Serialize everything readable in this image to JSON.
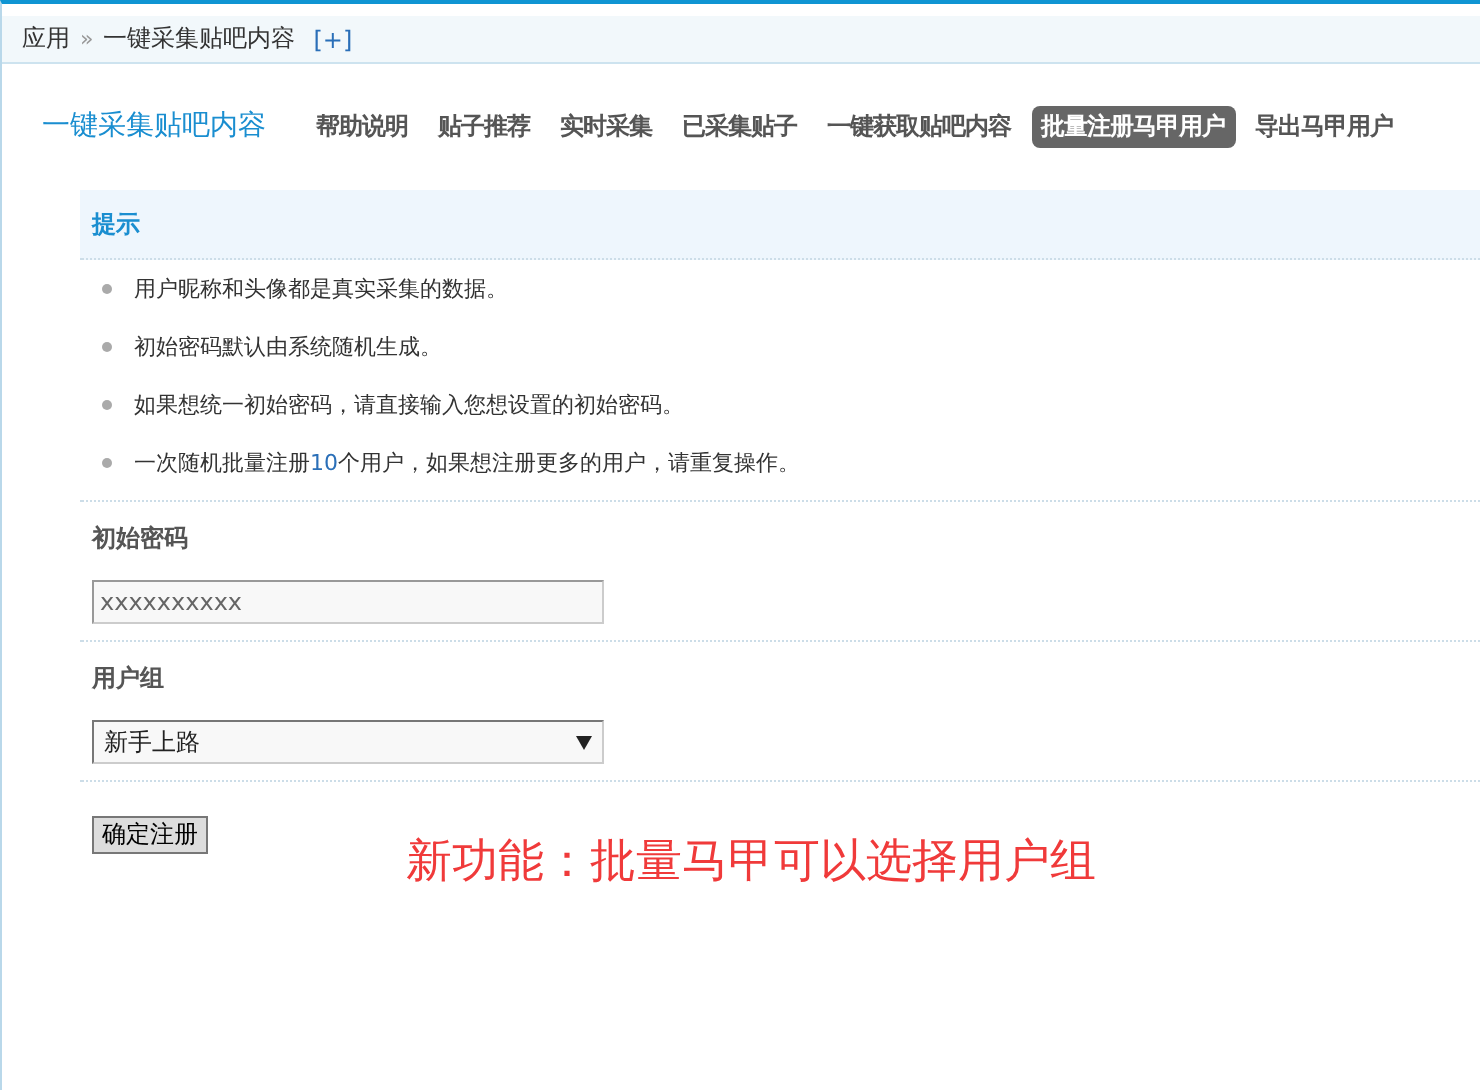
{
  "breadcrumb": {
    "items": [
      "应用",
      "一键采集贴吧内容"
    ],
    "separator": "»",
    "add_link": "[+]"
  },
  "page_title": "一键采集贴吧内容",
  "tabs": [
    {
      "label": "帮助说明",
      "selected": false
    },
    {
      "label": "贴子推荐",
      "selected": false
    },
    {
      "label": "实时采集",
      "selected": false
    },
    {
      "label": "已采集贴子",
      "selected": false
    },
    {
      "label": "一键获取贴吧内容",
      "selected": false
    },
    {
      "label": "批量注册马甲用户",
      "selected": true
    },
    {
      "label": "导出马甲用户",
      "selected": false
    }
  ],
  "tips": {
    "title": "提示",
    "items": [
      {
        "parts": [
          {
            "text": "用户昵称和头像都是真实采集的数据。",
            "highlight": false
          }
        ]
      },
      {
        "parts": [
          {
            "text": "初始密码默认由系统随机生成。",
            "highlight": false
          }
        ]
      },
      {
        "parts": [
          {
            "text": "如果想统一初始密码，请直接输入您想设置的初始密码。",
            "highlight": false
          }
        ]
      },
      {
        "parts": [
          {
            "text": "一次随机批量注册",
            "highlight": false
          },
          {
            "text": "10",
            "highlight": true
          },
          {
            "text": "个用户，如果想注册更多的用户，请重复操作。",
            "highlight": false
          }
        ]
      }
    ]
  },
  "password": {
    "label": "初始密码",
    "value": "xxxxxxxxxx"
  },
  "group": {
    "label": "用户组",
    "value": "新手上路"
  },
  "submit": "确定注册",
  "annotation": "新功能：批量马甲可以选择用户组"
}
